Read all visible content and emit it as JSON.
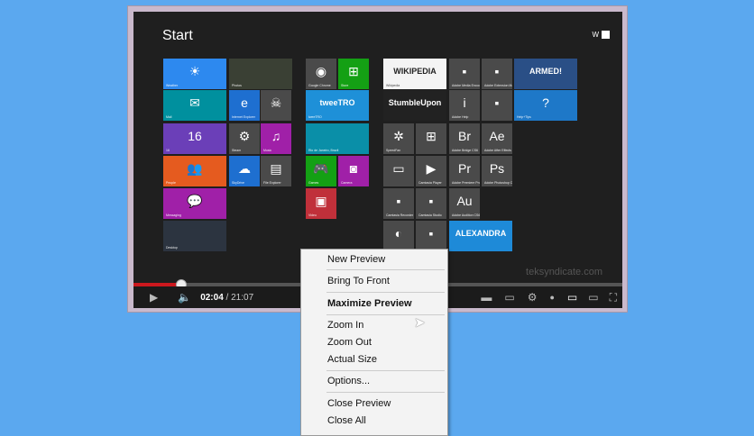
{
  "start": {
    "title": "Start",
    "user": "W"
  },
  "tiles": [
    {
      "label": "Weather",
      "color": "#2d89ef",
      "icon": "☀"
    },
    {
      "label": "Photos",
      "color": "#3a4034",
      "icon": ""
    },
    {
      "label": "Mail",
      "color": "#00909e",
      "icon": "✉"
    },
    {
      "label": "Internet Explorer",
      "color": "#1e6fd0",
      "icon": "e"
    },
    {
      "label": "",
      "color": "#4a4a4a",
      "icon": "☠"
    },
    {
      "label": "16",
      "color": "#6b3fb8",
      "icon": "16"
    },
    {
      "label": "Steam",
      "color": "#4a4a4a",
      "icon": "⚙"
    },
    {
      "label": "Music",
      "color": "#a020a8",
      "icon": "♫"
    },
    {
      "label": "People",
      "color": "#e55b1f",
      "icon": "👥"
    },
    {
      "label": "SkyDrive",
      "color": "#1e6fd0",
      "icon": "☁"
    },
    {
      "label": "File Explorer",
      "color": "#4a4a4a",
      "icon": "▤"
    },
    {
      "label": "Messaging",
      "color": "#a020a8",
      "icon": "💬"
    },
    {
      "label": "Desktop",
      "color": "#2c3440",
      "icon": ""
    },
    {
      "label": "Google Chrome",
      "color": "#4a4a4a",
      "icon": "◉"
    },
    {
      "label": "Store",
      "color": "#14a014",
      "icon": "⊞"
    },
    {
      "label": "tweeTRO",
      "color": "#1e90d8",
      "icon": "tweeTRO"
    },
    {
      "label": "Rio de Janeiro, Brazil",
      "color": "#0a8fa8",
      "icon": ""
    },
    {
      "label": "Games",
      "color": "#14a014",
      "icon": "🎮"
    },
    {
      "label": "Camera",
      "color": "#a020a8",
      "icon": "◙"
    },
    {
      "label": "Video",
      "color": "#c0303a",
      "icon": "▣"
    },
    {
      "label": "Wikipedia",
      "color": "#f4f4f4",
      "icon": "WIKIPEDIA"
    },
    {
      "label": "Adobe Media Encoder CS6",
      "color": "#4a4a4a",
      "icon": "▪"
    },
    {
      "label": "Adobe Extension Manager CS6",
      "color": "#4a4a4a",
      "icon": "▪"
    },
    {
      "label": "",
      "color": "#2a4f86",
      "icon": "ARMED!"
    },
    {
      "label": "",
      "color": "#222",
      "icon": "StumbleUpon"
    },
    {
      "label": "Adobe Help",
      "color": "#4a4a4a",
      "icon": "i"
    },
    {
      "label": "",
      "color": "#4a4a4a",
      "icon": "▪"
    },
    {
      "label": "Help+Tips",
      "color": "#1e78c8",
      "icon": "?"
    },
    {
      "label": "SpeedFan",
      "color": "#4a4a4a",
      "icon": "✲"
    },
    {
      "label": "",
      "color": "#4a4a4a",
      "icon": "⊞"
    },
    {
      "label": "Adobe Bridge CS6",
      "color": "#4a4a4a",
      "icon": "Br"
    },
    {
      "label": "Adobe After Effects CS6",
      "color": "#4a4a4a",
      "icon": "Ae"
    },
    {
      "label": "",
      "color": "#4a4a4a",
      "icon": "▭"
    },
    {
      "label": "Camtasia Player",
      "color": "#4a4a4a",
      "icon": "▶"
    },
    {
      "label": "Adobe Premiere Pro CS6",
      "color": "#4a4a4a",
      "icon": "Pr"
    },
    {
      "label": "Adobe Photoshop CS6",
      "color": "#4a4a4a",
      "icon": "Ps"
    },
    {
      "label": "Camtasia Recorder",
      "color": "#4a4a4a",
      "icon": "▪"
    },
    {
      "label": "Camtasia Studio",
      "color": "#4a4a4a",
      "icon": "▪"
    },
    {
      "label": "Adobe Audition CS6",
      "color": "#4a4a4a",
      "icon": "Au"
    },
    {
      "label": "",
      "color": "#4a4a4a",
      "icon": "◐"
    },
    {
      "label": "",
      "color": "#4a4a4a",
      "icon": "▪"
    },
    {
      "label": "",
      "color": "#1e8ad8",
      "icon": "ALEXANDRA"
    }
  ],
  "player": {
    "current_time": "02:04",
    "total_time": "/ 21:07",
    "watermark": "teksyndicate.com",
    "progress_percent": 9.8
  },
  "menu": {
    "items": [
      "New Preview",
      "Bring To Front",
      "Maximize Preview",
      "Zoom In",
      "Zoom Out",
      "Actual Size",
      "Options...",
      "Close Preview",
      "Close All"
    ]
  }
}
